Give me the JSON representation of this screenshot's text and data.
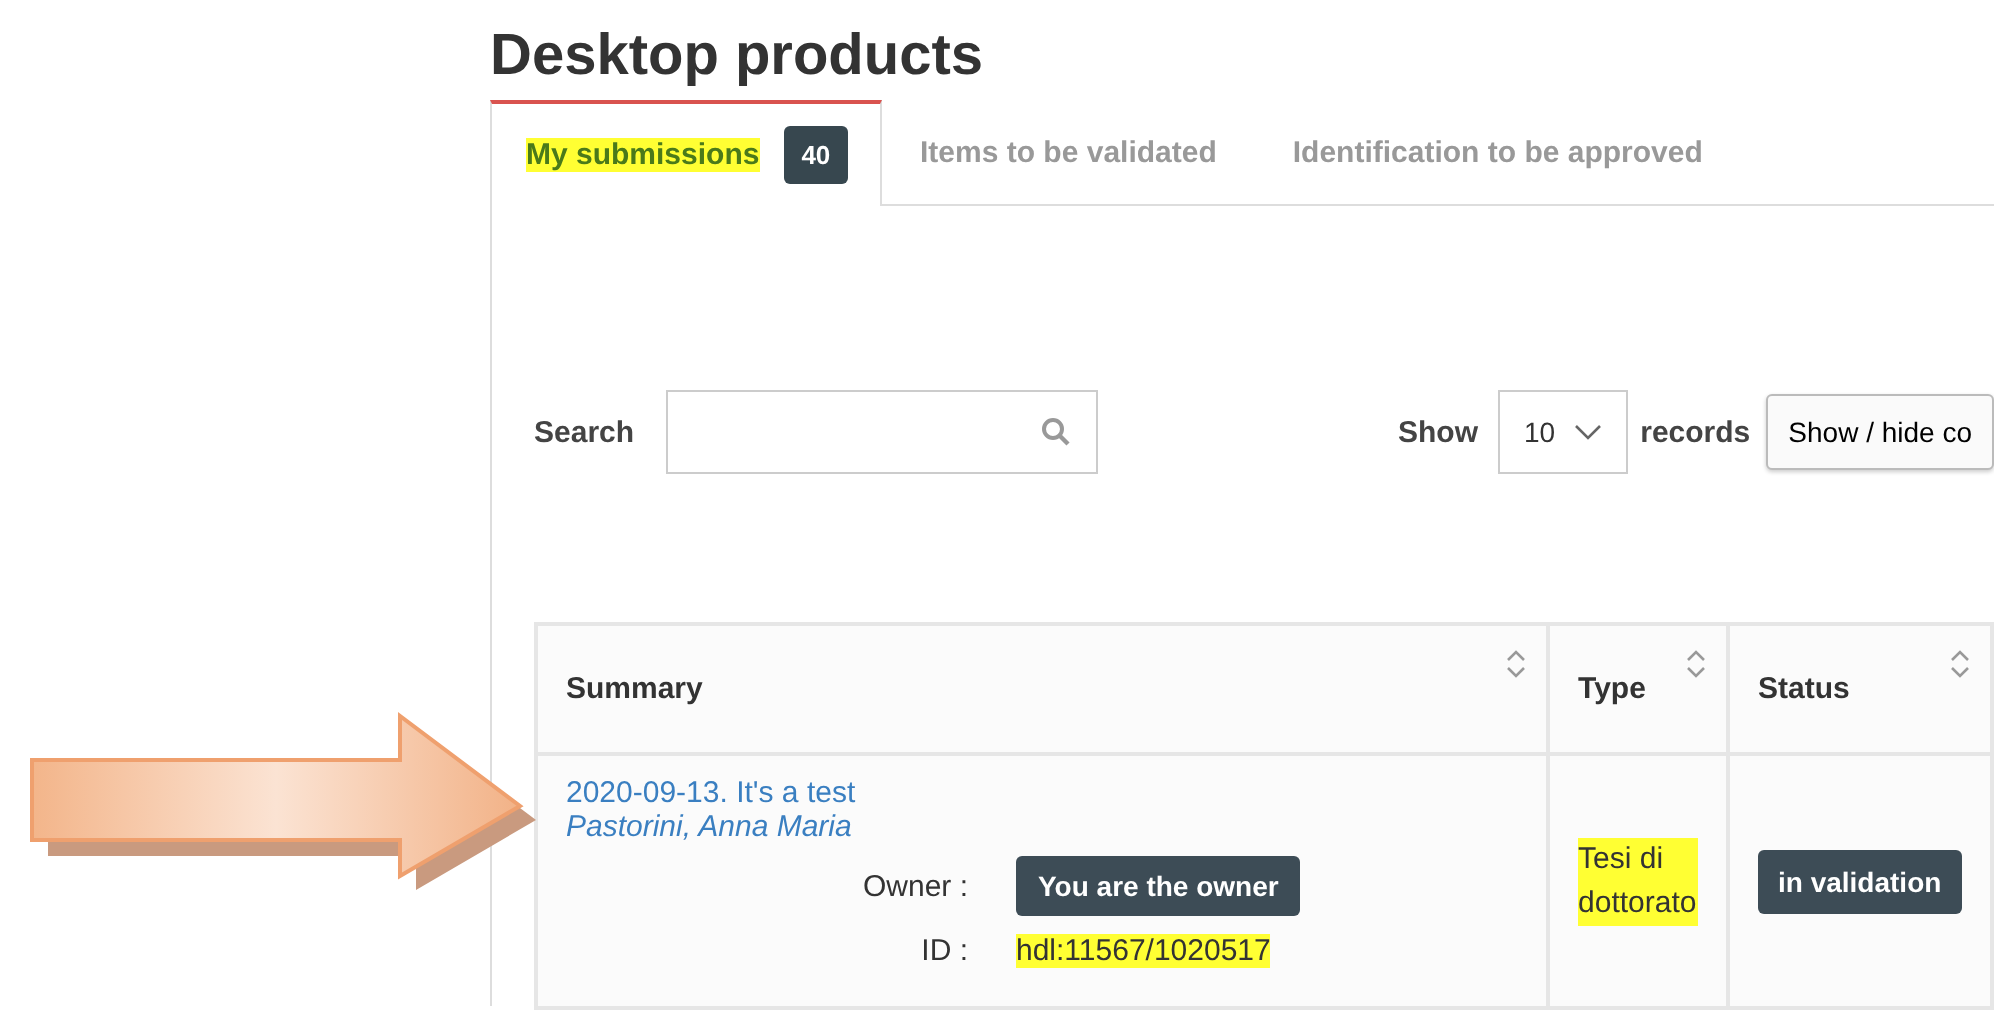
{
  "page_title": "Desktop products",
  "tabs": [
    {
      "label": "My submissions",
      "count": "40",
      "selected": true,
      "highlighted": true
    },
    {
      "label": "Items to be validated",
      "selected": false,
      "highlighted": false
    },
    {
      "label": "Identification to be approved",
      "selected": false,
      "highlighted": false
    }
  ],
  "search": {
    "label": "Search"
  },
  "show": {
    "label": "Show",
    "value": "10",
    "suffix": "records"
  },
  "column_toggle": {
    "label": "Show / hide co"
  },
  "table": {
    "columns": [
      "Summary",
      "Type",
      "Status"
    ],
    "rows": [
      {
        "title": "2020-09-13. It's a test",
        "authors": "Pastorini, Anna Maria",
        "owner_label": "Owner :",
        "owner": "You are the owner",
        "id_label": "ID :",
        "id": "hdl:11567/1020517",
        "id_highlighted": true,
        "type": "Tesi di dottorato",
        "type_highlighted": true,
        "status": "in validation"
      }
    ]
  },
  "annotation": {
    "kind": "arrow"
  }
}
